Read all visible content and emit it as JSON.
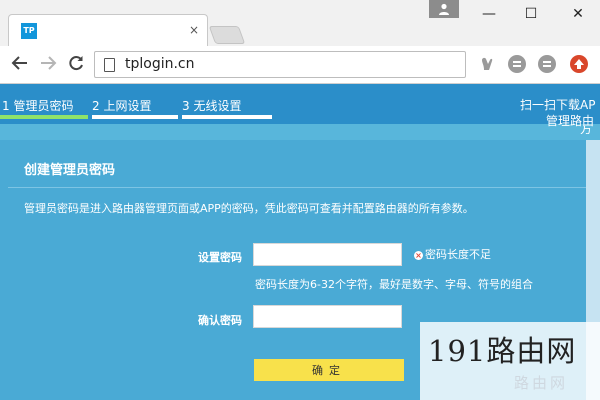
{
  "browser": {
    "tab": {
      "favicon_text": "TP",
      "close_symbol": "×"
    },
    "window_controls": {
      "minimize": "—",
      "maximize": "☐",
      "close": "✕"
    },
    "url": "tplogin.cn",
    "icons": {
      "back": "back-arrow-icon",
      "forward": "forward-arrow-icon",
      "reload": "reload-icon",
      "page": "page-icon",
      "ext1": "extension-icon",
      "ext2": "extension-icon",
      "ext3": "extension-icon",
      "ext4": "extension-icon"
    },
    "colors": {
      "ext_red": "#d9472b",
      "ext_gray": "#9a9a9a"
    }
  },
  "page": {
    "steps": [
      {
        "label": "1 管理员密码",
        "active": true
      },
      {
        "label": "2 上网设置",
        "active": false
      },
      {
        "label": "3 无线设置",
        "active": false
      }
    ],
    "qr_text": {
      "line1": "扫一扫下载AP",
      "line2": "管理路由",
      "line3": "方"
    },
    "form": {
      "title": "创建管理员密码",
      "description": "管理员密码是进入路由器管理页面或APP的密码，凭此密码可查看并配置路由器的所有参数。",
      "password_label": "设置密码",
      "password_value": "",
      "error_text": "密码长度不足",
      "hint": "密码长度为6-32个字符，最好是数字、字母、符号的组合",
      "confirm_label": "确认密码",
      "confirm_value": "",
      "submit_label": "确定"
    },
    "colors": {
      "header": "#2b8ec9",
      "card": "#4aaad5",
      "active_step": "#8fe36a",
      "step_inactive": "#ffffff",
      "button": "#f8e14b",
      "error": "#e04a3a"
    }
  },
  "watermark": {
    "main": "191路由网",
    "sub": "路由网"
  }
}
